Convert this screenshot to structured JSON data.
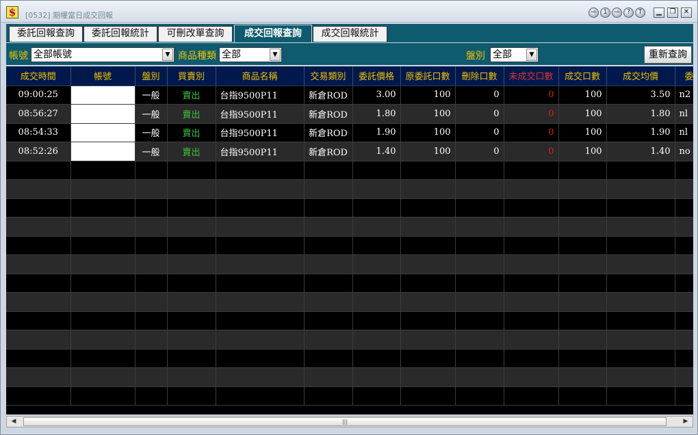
{
  "window": {
    "title": "[0532] 期權當日成交回報",
    "app_icon": "$"
  },
  "title_buttons": [
    "⇨",
    "1",
    "⇨",
    "?",
    "T"
  ],
  "tabs": [
    {
      "label": "委託回報查詢",
      "active": false
    },
    {
      "label": "委託回報統計",
      "active": false
    },
    {
      "label": "可刪改單查詢",
      "active": false
    },
    {
      "label": "成交回報查詢",
      "active": true
    },
    {
      "label": "成交回報統計",
      "active": false
    }
  ],
  "filters": {
    "account_label": "帳號",
    "account_value": "全部帳號",
    "product_label": "商品種類",
    "product_value": "全部",
    "session_label": "盤別",
    "session_value": "全部",
    "query_button": "重新查詢"
  },
  "table": {
    "columns": [
      "成交時間",
      "帳號",
      "盤別",
      "買賣別",
      "商品名稱",
      "交易類別",
      "委託價格",
      "原委託口數",
      "刪除口數",
      "未成交口數",
      "成交口數",
      "成交均價",
      "委託"
    ],
    "rows": [
      {
        "time": "09:00:25",
        "account": "",
        "session": "一般",
        "side": "賣出",
        "product": "台指9500P11",
        "trade_type": "新倉ROD",
        "price": "3.00",
        "orig_qty": "100",
        "cancel_qty": "0",
        "unfilled_qty": "0",
        "filled_qty": "100",
        "avg_price": "3.50",
        "order_no": "n2"
      },
      {
        "time": "08:56:27",
        "account": "",
        "session": "一般",
        "side": "賣出",
        "product": "台指9500P11",
        "trade_type": "新倉ROD",
        "price": "1.80",
        "orig_qty": "100",
        "cancel_qty": "0",
        "unfilled_qty": "0",
        "filled_qty": "100",
        "avg_price": "1.80",
        "order_no": "nl"
      },
      {
        "time": "08:54:33",
        "account": "",
        "session": "一般",
        "side": "賣出",
        "product": "台指9500P11",
        "trade_type": "新倉ROD",
        "price": "1.90",
        "orig_qty": "100",
        "cancel_qty": "0",
        "unfilled_qty": "0",
        "filled_qty": "100",
        "avg_price": "1.90",
        "order_no": "nl"
      },
      {
        "time": "08:52:26",
        "account": "",
        "session": "一般",
        "side": "賣出",
        "product": "台指9500P11",
        "trade_type": "新倉ROD",
        "price": "1.40",
        "orig_qty": "100",
        "cancel_qty": "0",
        "unfilled_qty": "0",
        "filled_qty": "100",
        "avg_price": "1.40",
        "order_no": "no"
      }
    ]
  },
  "colors": {
    "header_bg": "#00194d",
    "header_text": "#f0c000",
    "sell": "#3bc23b",
    "unfilled": "#e02020",
    "toolbar_bg": "#0e5a6e"
  }
}
